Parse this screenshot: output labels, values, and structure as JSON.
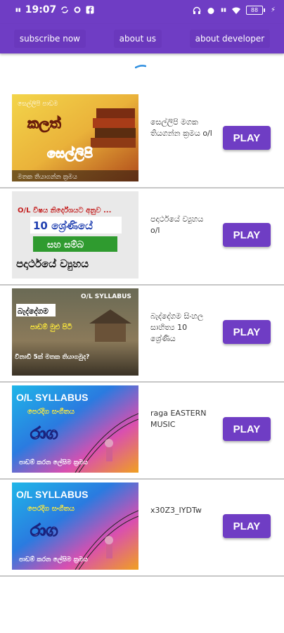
{
  "status": {
    "time": "19:07",
    "battery": "88"
  },
  "tabs": [
    {
      "label": "subscribe now"
    },
    {
      "label": "about us"
    },
    {
      "label": "about developer"
    }
  ],
  "items": [
    {
      "title": "සෙල්ලිපි මගක තියගන්න ක්‍රමය o/l",
      "button": "PLAY",
      "thumb": {
        "line1": "සෙල්ලිපි පාඩම",
        "line2": "කලත්",
        "line3": "සෙල්ලිපි",
        "line4": "මතක තියාගන්න ක්‍රමය"
      }
    },
    {
      "title": "පදාර්ථයේ ව්‍යුහය o/l",
      "button": "PLAY",
      "thumb": {
        "line1": "O/L විෂය නිර්දේශයට අනුව ...",
        "line2": "10 ශ්‍රේණියේ",
        "line3": "සහ සම්බ",
        "line4": "පදාර්ථයේ ව්‍යුහය"
      }
    },
    {
      "title": "බැද්දේගම සිංහල සාහිත්‍ය 10 ශ්‍රේණිය",
      "button": "PLAY",
      "thumb": {
        "line1": "O/L SYLLABUS",
        "line2": "බැද්දේගම",
        "line3": "පාඩම් මුළු පිටි",
        "line4": "විනාඩි 5ක් මතක තියාගමුද?"
      }
    },
    {
      "title": "raga EASTERN MUSIC",
      "button": "PLAY",
      "thumb": {
        "line1": "O/L SYLLABUS",
        "line2": "පෙරදිග සංගීතය",
        "line3": "රාග",
        "line4": "පාඩම් කරන ලේසිම ක්‍රමය"
      }
    },
    {
      "title": "x30Z3_IYDTw",
      "button": "PLAY",
      "thumb": {
        "line1": "O/L SYLLABUS",
        "line2": "පෙරදිග සංගීතය",
        "line3": "රාග",
        "line4": "පාඩම් කරන ලේසිම ක්‍රමය"
      }
    }
  ],
  "colors": {
    "accent": "#6f3dc4"
  }
}
